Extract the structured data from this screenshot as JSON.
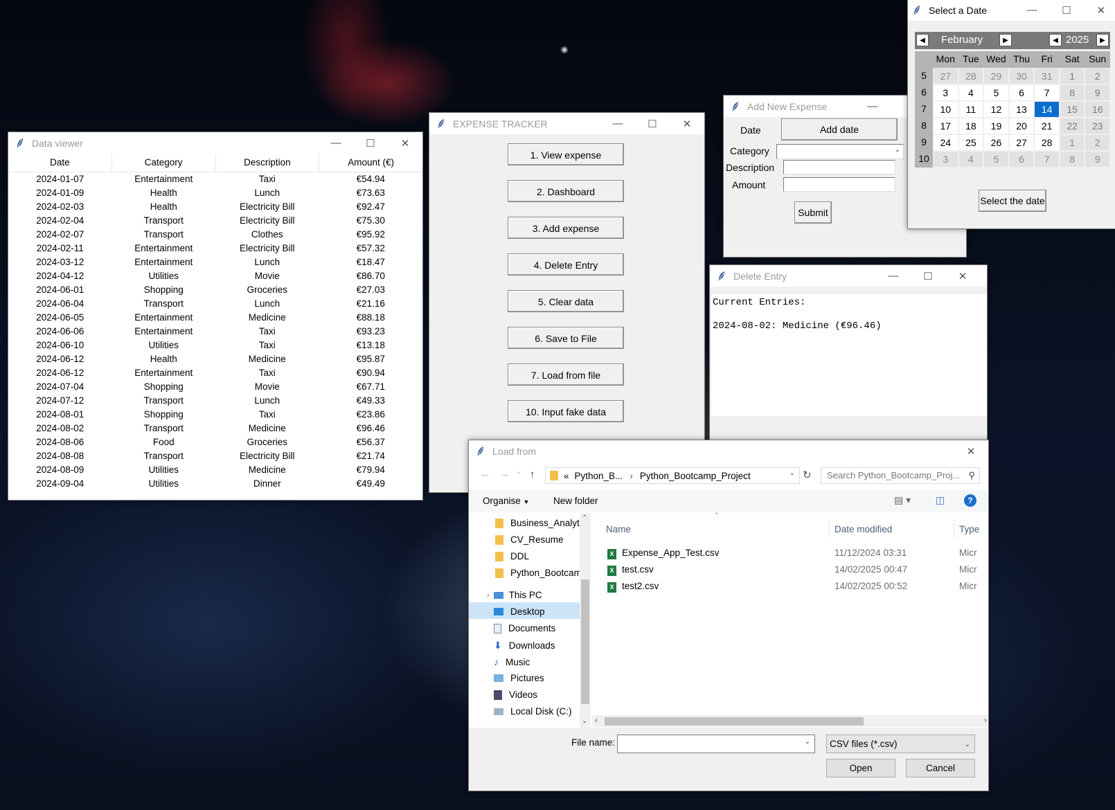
{
  "data_viewer": {
    "title": "Data viewer",
    "columns": [
      "Date",
      "Category",
      "Description",
      "Amount (€)"
    ],
    "rows": [
      [
        "2024-01-07",
        "Entertainment",
        "Taxi",
        "€54.94"
      ],
      [
        "2024-01-09",
        "Health",
        "Lunch",
        "€73.63"
      ],
      [
        "2024-02-03",
        "Health",
        "Electricity Bill",
        "€92.47"
      ],
      [
        "2024-02-04",
        "Transport",
        "Electricity Bill",
        "€75.30"
      ],
      [
        "2024-02-07",
        "Transport",
        "Clothes",
        "€95.92"
      ],
      [
        "2024-02-11",
        "Entertainment",
        "Electricity Bill",
        "€57.32"
      ],
      [
        "2024-03-12",
        "Entertainment",
        "Lunch",
        "€18.47"
      ],
      [
        "2024-04-12",
        "Utilities",
        "Movie",
        "€86.70"
      ],
      [
        "2024-06-01",
        "Shopping",
        "Groceries",
        "€27.03"
      ],
      [
        "2024-06-04",
        "Transport",
        "Lunch",
        "€21.16"
      ],
      [
        "2024-06-05",
        "Entertainment",
        "Medicine",
        "€88.18"
      ],
      [
        "2024-06-06",
        "Entertainment",
        "Taxi",
        "€93.23"
      ],
      [
        "2024-06-10",
        "Utilities",
        "Taxi",
        "€13.18"
      ],
      [
        "2024-06-12",
        "Health",
        "Medicine",
        "€95.87"
      ],
      [
        "2024-06-12",
        "Entertainment",
        "Taxi",
        "€90.94"
      ],
      [
        "2024-07-04",
        "Shopping",
        "Movie",
        "€67.71"
      ],
      [
        "2024-07-12",
        "Transport",
        "Lunch",
        "€49.33"
      ],
      [
        "2024-08-01",
        "Shopping",
        "Taxi",
        "€23.86"
      ],
      [
        "2024-08-02",
        "Transport",
        "Medicine",
        "€96.46"
      ],
      [
        "2024-08-06",
        "Food",
        "Groceries",
        "€56.37"
      ],
      [
        "2024-08-08",
        "Transport",
        "Electricity Bill",
        "€21.74"
      ],
      [
        "2024-08-09",
        "Utilities",
        "Medicine",
        "€79.94"
      ],
      [
        "2024-09-04",
        "Utilities",
        "Dinner",
        "€49.49"
      ]
    ]
  },
  "expense_tracker": {
    "title": "EXPENSE TRACKER",
    "buttons": [
      "1. View expense",
      "2. Dashboard",
      "3. Add expense",
      "4. Delete Entry",
      "5. Clear data",
      "6. Save to File",
      "7. Load from file",
      "10. Input fake data"
    ]
  },
  "add_expense": {
    "title": "Add New Expense",
    "date_label": "Date",
    "add_date_button": "Add date",
    "category_label": "Category",
    "category_value": "",
    "description_label": "Description",
    "description_value": "",
    "amount_label": "Amount",
    "amount_value": "",
    "submit_button": "Submit"
  },
  "date_picker": {
    "title": "Select a Date",
    "month": "February",
    "year": "2025",
    "weekdays": [
      "Mon",
      "Tue",
      "Wed",
      "Thu",
      "Fri",
      "Sat",
      "Sun"
    ],
    "weeks": [
      {
        "num": "5",
        "days": [
          "27",
          "28",
          "29",
          "30",
          "31",
          "1",
          "2"
        ]
      },
      {
        "num": "6",
        "days": [
          "3",
          "4",
          "5",
          "6",
          "7",
          "8",
          "9"
        ]
      },
      {
        "num": "7",
        "days": [
          "10",
          "11",
          "12",
          "13",
          "14",
          "15",
          "16"
        ]
      },
      {
        "num": "8",
        "days": [
          "17",
          "18",
          "19",
          "20",
          "21",
          "22",
          "23"
        ]
      },
      {
        "num": "9",
        "days": [
          "24",
          "25",
          "26",
          "27",
          "28",
          "1",
          "2"
        ]
      },
      {
        "num": "10",
        "days": [
          "3",
          "4",
          "5",
          "6",
          "7",
          "8",
          "9"
        ]
      }
    ],
    "selected_day": "14",
    "select_button": "Select the date"
  },
  "delete_entry": {
    "title": "Delete Entry",
    "header": "Current Entries:",
    "entries": [
      "2024-08-02: Medicine (€96.46)"
    ]
  },
  "load_dialog": {
    "title": "Load from",
    "path": [
      "Python_B...",
      "Python_Bootcamp_Project"
    ],
    "search_placeholder": "Search Python_Bootcamp_Proj...",
    "organise": "Organise",
    "new_folder": "New folder",
    "nav_folders": [
      "Business_Analytic",
      "CV_Resume",
      "DDL",
      "Python_Bootcam"
    ],
    "this_pc": "This PC",
    "pc_items": [
      "Desktop",
      "Documents",
      "Downloads",
      "Music",
      "Pictures",
      "Videos",
      "Local Disk (C:)"
    ],
    "columns": [
      "Name",
      "Date modified",
      "Type"
    ],
    "files": [
      {
        "name": "Expense_App_Test.csv",
        "modified": "11/12/2024 03:31",
        "type": "Micr"
      },
      {
        "name": "test.csv",
        "modified": "14/02/2025 00:47",
        "type": "Micr"
      },
      {
        "name": "test2.csv",
        "modified": "14/02/2025 00:52",
        "type": "Micr"
      }
    ],
    "filename_label": "File name:",
    "filename_value": "",
    "filetype": "CSV files (*.csv)",
    "open_button": "Open",
    "cancel_button": "Cancel"
  },
  "colors": {
    "selected_day": "#0a6ecf",
    "accent": "#0078d7"
  }
}
